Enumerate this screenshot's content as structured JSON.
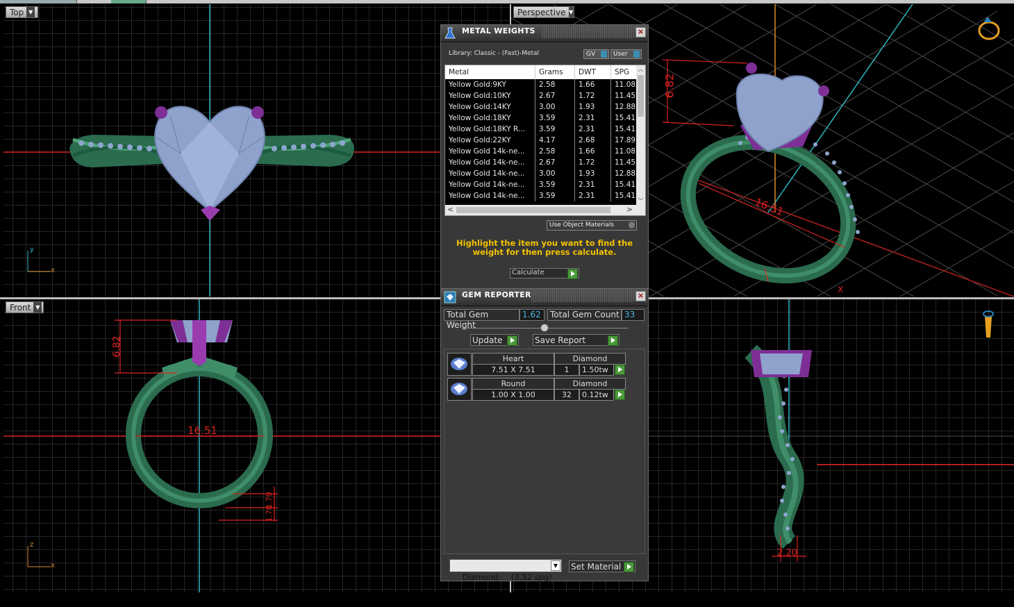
{
  "viewports": {
    "top": {
      "label": "Top",
      "axis_v": "y",
      "axis_h": "x"
    },
    "perspective": {
      "label": "Perspective",
      "dim_height": "6.82",
      "dim_width": "16.51",
      "dim_x": "X"
    },
    "front": {
      "label": "Front",
      "axis_v": "z",
      "axis_h": "x",
      "dim_height": "6.82",
      "dim_inner": "16.51",
      "dim_a": "1.70",
      "dim_b": "1.70"
    },
    "right": {
      "dim_width": "2.20"
    }
  },
  "metal_weights": {
    "title": "METAL WEIGHTS",
    "library": "Library: Classic - (Fast)-Metal",
    "toggle_gv": "GV",
    "toggle_user": "User",
    "columns": [
      "Metal",
      "Grams",
      "DWT",
      "SPG"
    ],
    "rows": [
      {
        "metal": "Yellow Gold:9KY",
        "grams": "2.58",
        "dwt": "1.66",
        "spg": "11.08"
      },
      {
        "metal": "Yellow Gold:10KY",
        "grams": "2.67",
        "dwt": "1.72",
        "spg": "11.45"
      },
      {
        "metal": "Yellow Gold:14KY",
        "grams": "3.00",
        "dwt": "1.93",
        "spg": "12.88"
      },
      {
        "metal": "Yellow Gold:18KY",
        "grams": "3.59",
        "dwt": "2.31",
        "spg": "15.41"
      },
      {
        "metal": "Yellow Gold:18KY R...",
        "grams": "3.59",
        "dwt": "2.31",
        "spg": "15.41"
      },
      {
        "metal": "Yellow Gold:22KY",
        "grams": "4.17",
        "dwt": "2.68",
        "spg": "17.89"
      },
      {
        "metal": "Yellow Gold 14k-ne...",
        "grams": "2.58",
        "dwt": "1.66",
        "spg": "11.08"
      },
      {
        "metal": "Yellow Gold 14k-ne...",
        "grams": "2.67",
        "dwt": "1.72",
        "spg": "11.45"
      },
      {
        "metal": "Yellow Gold 14k-ne...",
        "grams": "3.00",
        "dwt": "1.93",
        "spg": "12.88"
      },
      {
        "metal": "Yellow Gold 14k-ne...",
        "grams": "3.59",
        "dwt": "2.31",
        "spg": "15.41"
      },
      {
        "metal": "Yellow Gold 14k-ne...",
        "grams": "3.59",
        "dwt": "2.31",
        "spg": "15.41"
      }
    ],
    "use_object_materials": "Use Object Materials",
    "instruction": "Highlight the item you want to find the weight for then press calculate.",
    "calculate_label": "Calculate"
  },
  "gem_reporter": {
    "title": "GEM REPORTER",
    "total_weight_label": "Total Gem Weight",
    "total_weight_value": "1.62",
    "total_count_label": "Total Gem Count",
    "total_count_value": "33",
    "update_label": "Update",
    "save_report_label": "Save Report",
    "gems": [
      {
        "shape": "Heart",
        "material": "Diamond",
        "size": "7.51 X 7.51",
        "count": "1",
        "weight": "1.50tw"
      },
      {
        "shape": "Round",
        "material": "Diamond",
        "size": "1.00 X 1.00",
        "count": "32",
        "weight": "0.12tw"
      }
    ],
    "material_select": "Diamond     (3.52 spg)",
    "set_material_label": "Set Material"
  }
}
